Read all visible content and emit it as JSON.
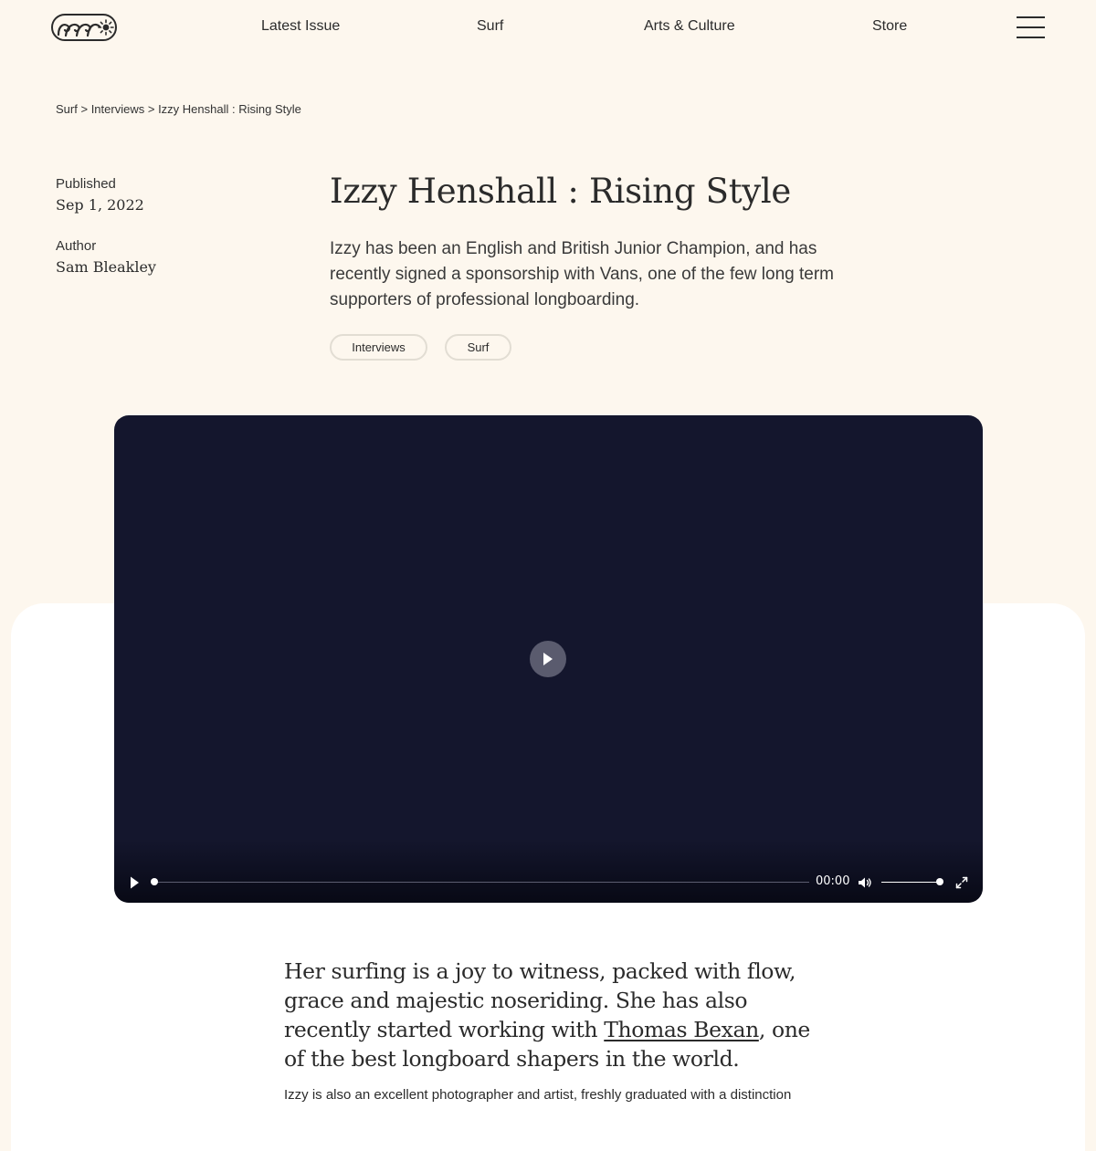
{
  "header": {
    "logo_name": "wave-sun-logo",
    "nav": [
      "Latest Issue",
      "Surf",
      "Arts & Culture",
      "Store"
    ],
    "menu_icon": "hamburger-menu-icon"
  },
  "breadcrumb": {
    "items": [
      "Surf",
      "Interviews",
      "Izzy Henshall : Rising Style"
    ],
    "separator": ">"
  },
  "meta": {
    "published_label": "Published",
    "published_value": "Sep 1, 2022",
    "author_label": "Author",
    "author_value": "Sam Bleakley"
  },
  "article": {
    "title": "Izzy Henshall : Rising Style",
    "lede": "Izzy has been an English and British Junior Champion, and has recently signed a sponsorship with Vans, one of the few long term supporters of professional longboarding.",
    "tags": [
      "Interviews",
      "Surf"
    ],
    "quote_before": "Her surfing is a joy to witness, packed with flow, grace and majestic noseriding. She has also recently started working with ",
    "quote_link": "Thomas Bexan",
    "quote_after": ", one of the best longboard shapers in the world.",
    "body_partial": "Izzy is also an excellent photographer and artist, freshly graduated with a distinction"
  },
  "video": {
    "time": "00:00",
    "progress": 0,
    "volume": 1,
    "play_icon": "play-icon",
    "volume_icon": "volume-icon",
    "fullscreen_icon": "fullscreen-icon"
  },
  "colors": {
    "page_background": "#fdf7ee",
    "panel_background": "#ffffff",
    "video_background": "#14162d",
    "text": "#2b2b2b",
    "tag_border": "#e2ddd3"
  }
}
